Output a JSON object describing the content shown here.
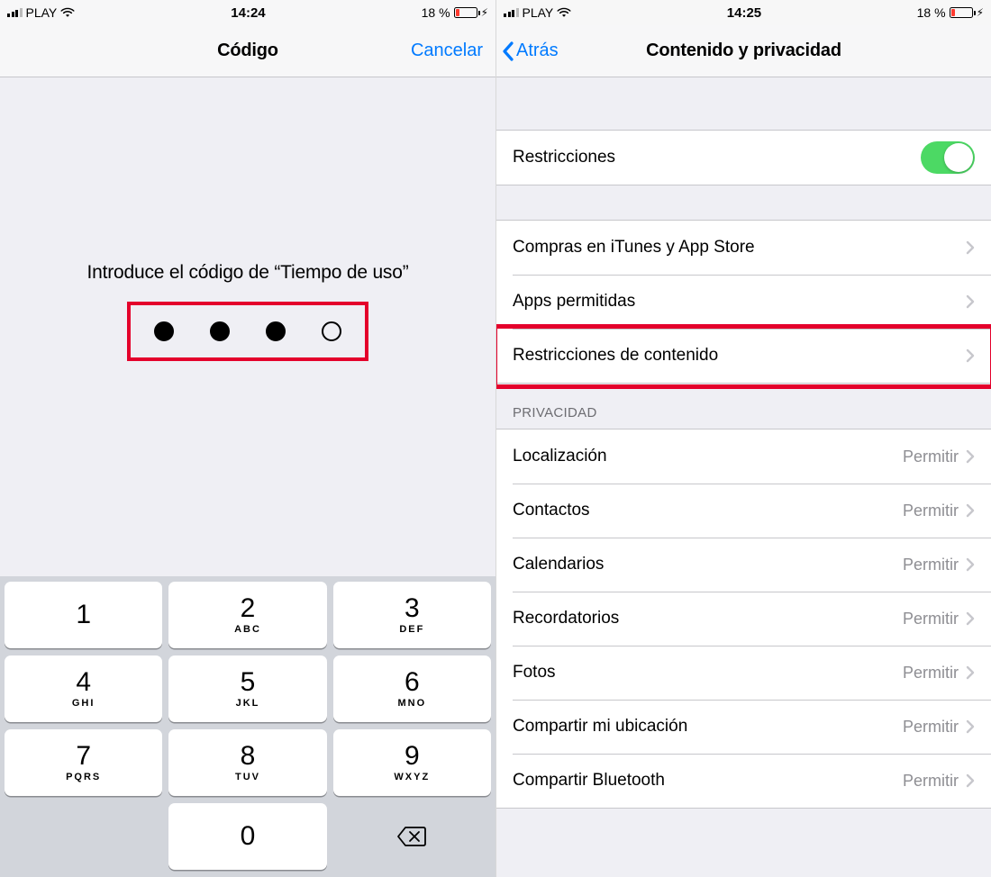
{
  "left": {
    "status": {
      "carrier": "PLAY",
      "time": "14:24",
      "battery_pct": "18 %"
    },
    "nav": {
      "title": "Código",
      "cancel": "Cancelar"
    },
    "prompt": "Introduce el código de “Tiempo de uso”",
    "dots_filled": 3,
    "dots_total": 4,
    "keypad": [
      {
        "num": "1",
        "sub": ""
      },
      {
        "num": "2",
        "sub": "ABC"
      },
      {
        "num": "3",
        "sub": "DEF"
      },
      {
        "num": "4",
        "sub": "GHI"
      },
      {
        "num": "5",
        "sub": "JKL"
      },
      {
        "num": "6",
        "sub": "MNO"
      },
      {
        "num": "7",
        "sub": "PQRS"
      },
      {
        "num": "8",
        "sub": "TUV"
      },
      {
        "num": "9",
        "sub": "WXYZ"
      },
      {
        "blank": true
      },
      {
        "num": "0",
        "sub": ""
      },
      {
        "delete": true
      }
    ]
  },
  "right": {
    "status": {
      "carrier": "PLAY",
      "time": "14:25",
      "battery_pct": "18 %"
    },
    "nav": {
      "back": "Atrás",
      "title": "Contenido y privacidad"
    },
    "restrictions_label": "Restricciones",
    "restrictions_on": true,
    "group1": [
      {
        "label": "Compras en iTunes y App Store"
      },
      {
        "label": "Apps permitidas"
      },
      {
        "label": "Restricciones de contenido",
        "highlight": true
      }
    ],
    "privacy_header": "PRIVACIDAD",
    "privacy_rows": [
      {
        "label": "Localización",
        "value": "Permitir"
      },
      {
        "label": "Contactos",
        "value": "Permitir"
      },
      {
        "label": "Calendarios",
        "value": "Permitir"
      },
      {
        "label": "Recordatorios",
        "value": "Permitir"
      },
      {
        "label": "Fotos",
        "value": "Permitir"
      },
      {
        "label": "Compartir mi ubicación",
        "value": "Permitir"
      },
      {
        "label": "Compartir Bluetooth",
        "value": "Permitir"
      }
    ]
  }
}
